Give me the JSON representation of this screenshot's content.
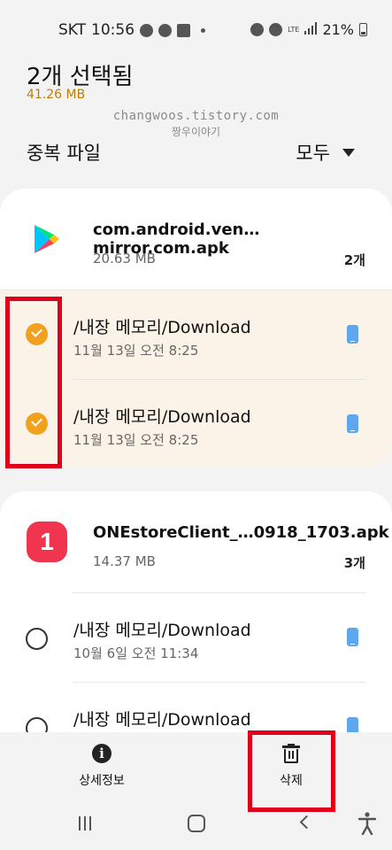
{
  "status_bar": {
    "carrier": "SKT",
    "time": "10:56",
    "network": "LTE",
    "battery": "21%"
  },
  "header": {
    "title": "2개 선택됨",
    "total_size": "41.26 MB"
  },
  "watermark": {
    "line1": "changwoos.tistory.com",
    "line2": "짱우이야기"
  },
  "section": {
    "label": "중복 파일",
    "sort": "모두"
  },
  "groups": [
    {
      "name": "com.android.ven…mirror.com.apk",
      "size": "20.63 MB",
      "count": "2개",
      "icon": "google-play-icon",
      "files": [
        {
          "path": "/내장 메모리/Download",
          "date": "11월 13일 오전 8:25",
          "selected": true
        },
        {
          "path": "/내장 메모리/Download",
          "date": "11월 13일 오전 8:25",
          "selected": true
        }
      ]
    },
    {
      "name": "ONEstoreClient_…0918_1703.apk",
      "size": "14.37 MB",
      "count": "3개",
      "icon": "onestore-icon",
      "icon_label": "1",
      "files": [
        {
          "path": "/내장 메모리/Download",
          "date": "10월 6일 오전 11:34",
          "selected": false
        },
        {
          "path": "/내장 메모리/Download",
          "date": "",
          "selected": false
        }
      ]
    }
  ],
  "actions": {
    "details": "상세정보",
    "delete": "삭제"
  },
  "colors": {
    "accent": "#f0a11e",
    "highlight": "#e0001b",
    "selected_row": "#fbf3e8",
    "phone_icon": "#5ea7ef"
  }
}
